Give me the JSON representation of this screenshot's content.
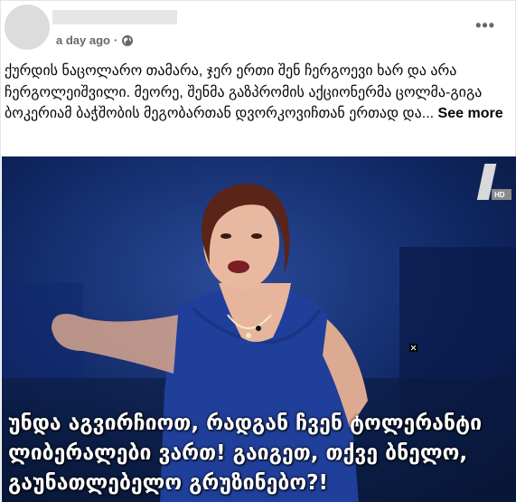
{
  "post": {
    "time": "a day ago",
    "separator": "·",
    "privacy_icon": "globe-icon",
    "more_icon": "more-options-icon",
    "more_label": "•••",
    "caption_text": "ქურდის ნაცოლარო თამარა, ჯერ ერთი შენ ჩერგოევი ხარ და არა ჩერგოლეიშვილი. მეორე, შენმა გაზპრომის აქციონერმა ცოლმა-გიგა ბოკერიამ ბაჭშობის მეგობართან დვორკოვიჩთან ერთად და...",
    "see_more": "See more"
  },
  "video": {
    "channel_logo": "first-channel-logo",
    "channel_badge": "HD",
    "subtitle_line1": "უნდა აგვირჩიოთ, რადგან ჩვენ ტოლერანტი",
    "subtitle_line2": "ლიბერალები ვართ! გაიგეთ, თქვე ბნელო,",
    "subtitle_line3": "გაუნათლებელო გრუზინებო?!"
  },
  "colors": {
    "studio_bg": "#0b1b47",
    "dress": "#1f3f9a",
    "subtitle": "#ffffff"
  }
}
